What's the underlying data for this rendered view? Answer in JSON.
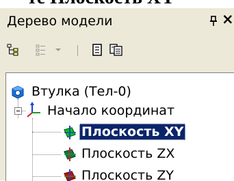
{
  "page_heading": "те Плоскость XY",
  "panel": {
    "title": "Дерево модели"
  },
  "toolbar": {
    "buttons": [
      "tree-structure-icon",
      "view-list-icon",
      "dropdown-arrow-icon",
      "document-icon",
      "documents-icon"
    ]
  },
  "tree": {
    "items": [
      {
        "label": "Втулка (Тел-0)",
        "icon": "part-icon",
        "selected": false
      },
      {
        "label": "Начало координат",
        "icon": "axes-icon",
        "selected": false,
        "expanded": true
      },
      {
        "label": "Плоскость XY",
        "icon": "plane-xy-icon",
        "selected": true,
        "color": "#00cc00"
      },
      {
        "label": "Плоскость ZX",
        "icon": "plane-zx-icon",
        "selected": false,
        "color": "#007a4a"
      },
      {
        "label": "Плоскость ZY",
        "icon": "plane-zy-icon",
        "selected": false,
        "color": "#cc0000"
      }
    ]
  }
}
